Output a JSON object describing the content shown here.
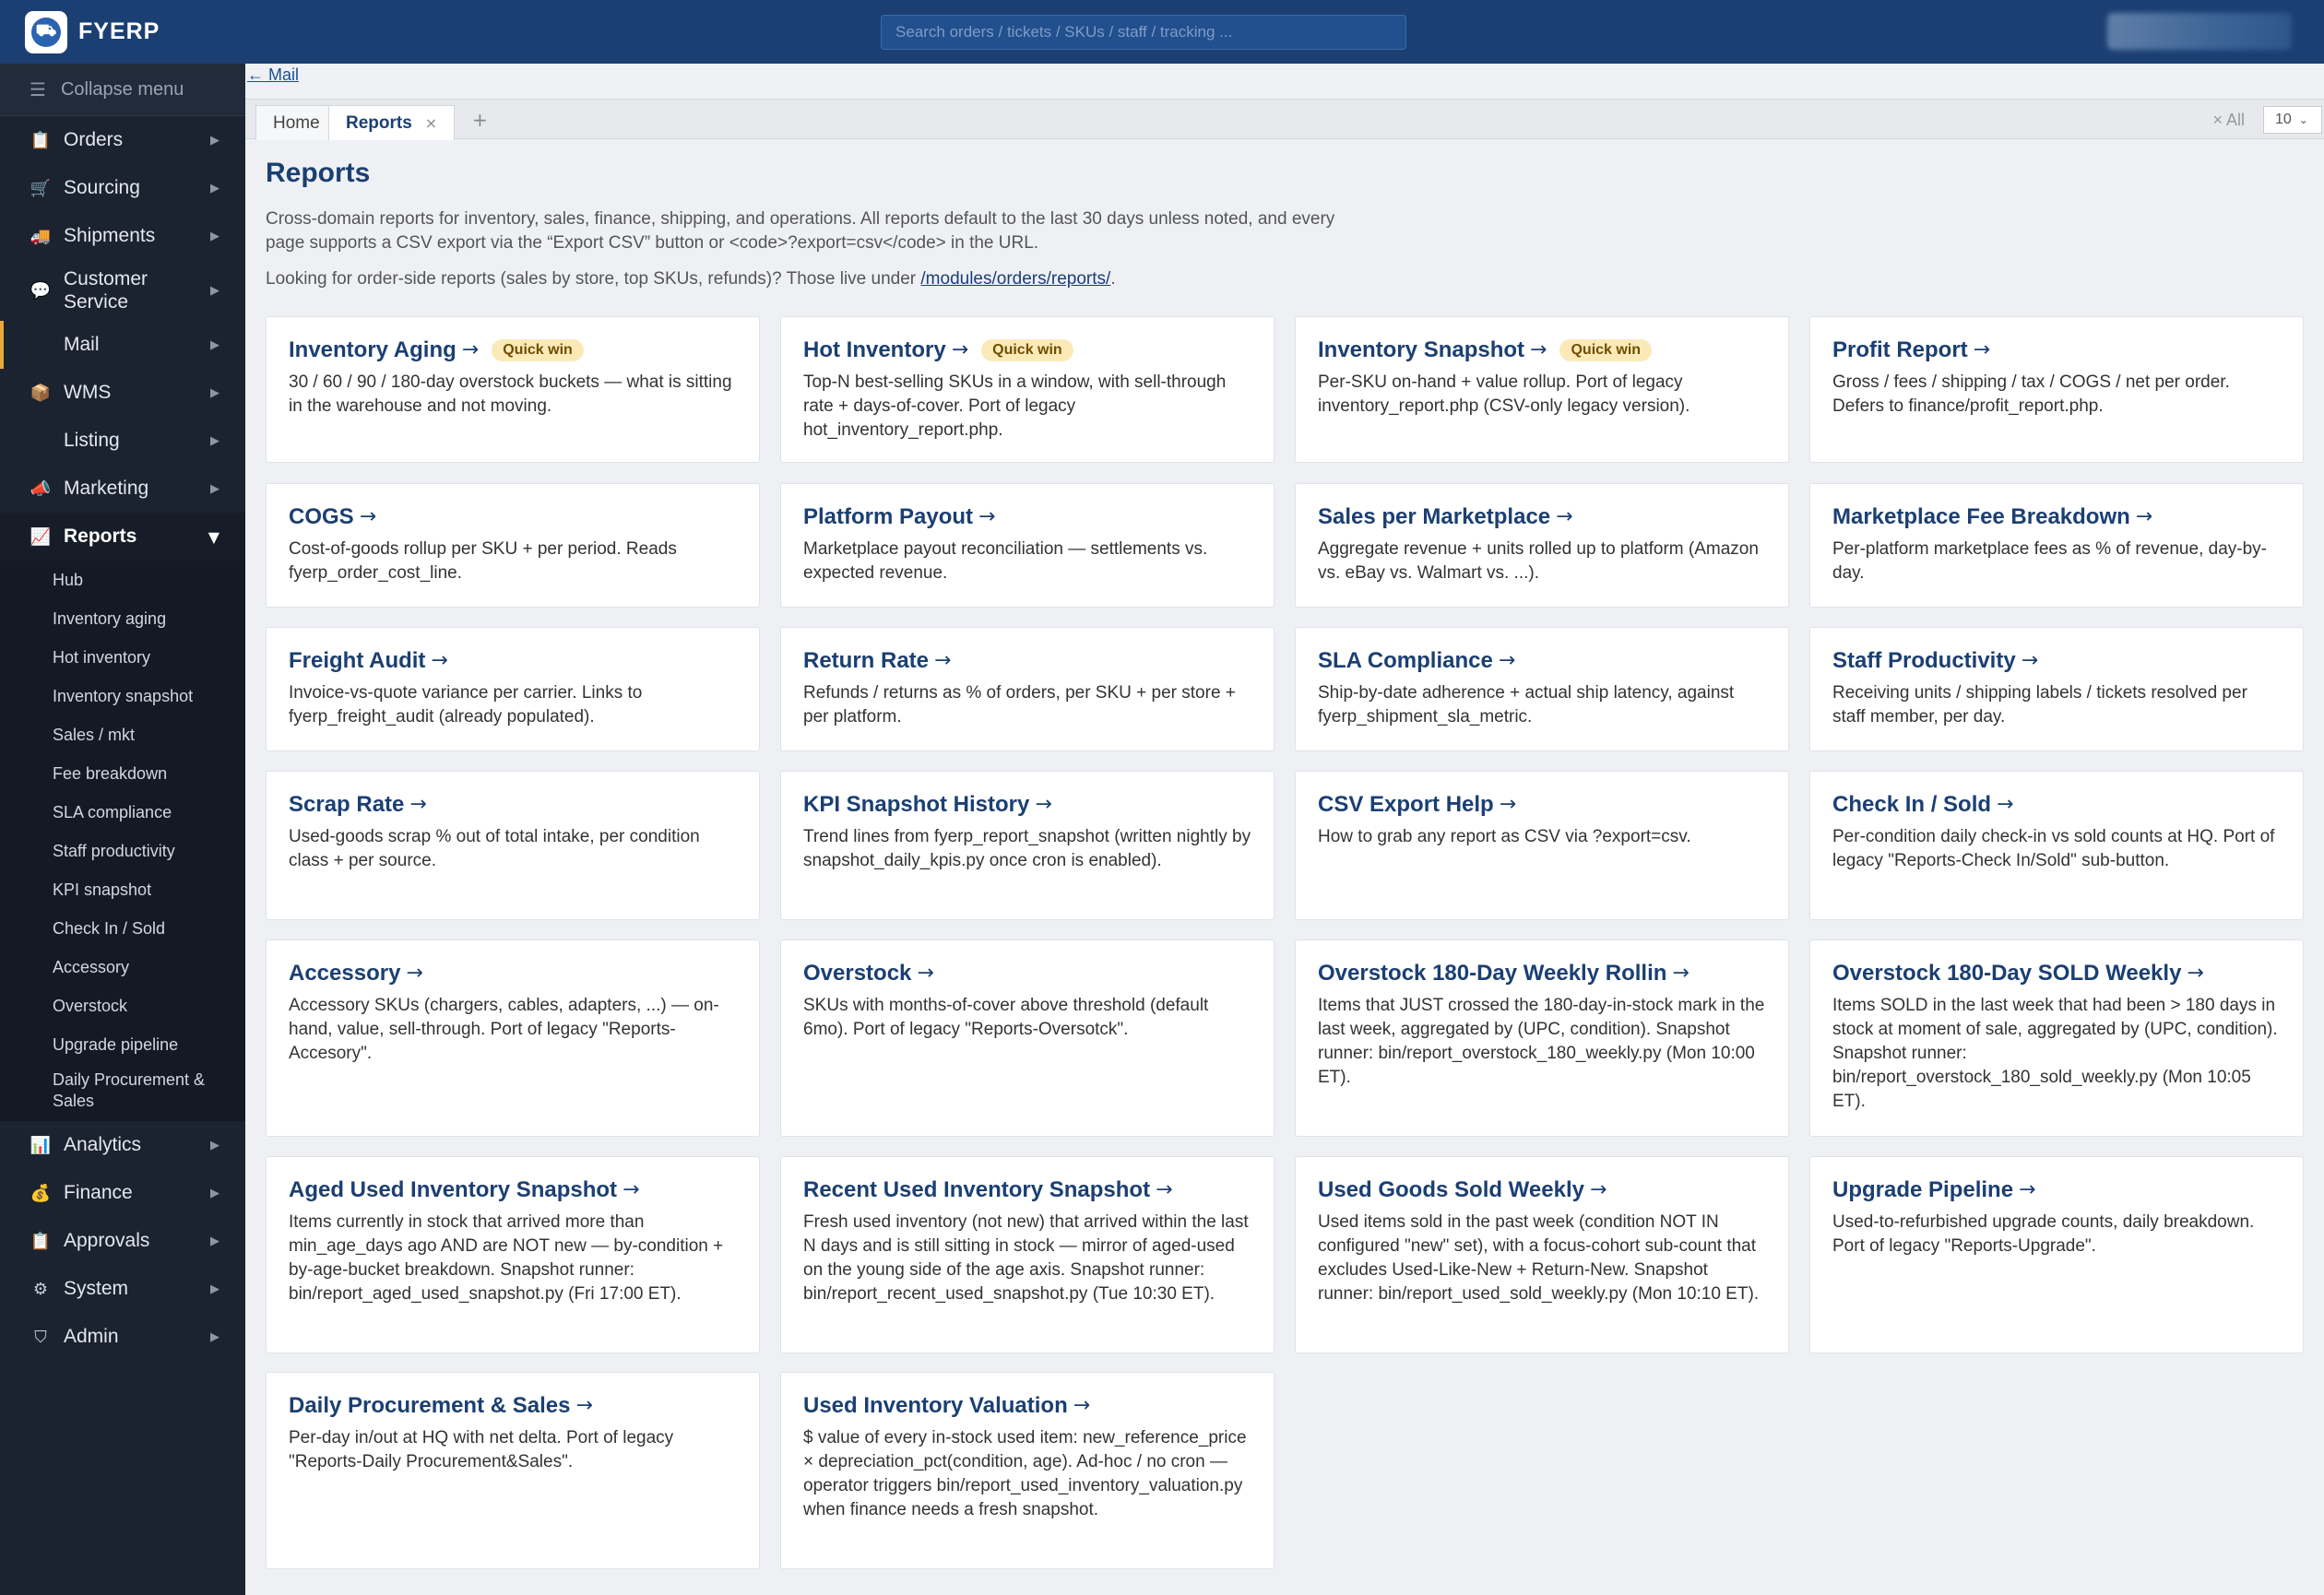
{
  "app": {
    "brand": "FYERP",
    "search_placeholder": "Search orders / tickets / SKUs / staff / tracking ..."
  },
  "sidebar": {
    "collapse_label": "Collapse menu",
    "items": [
      {
        "label": "Orders",
        "icon": "clipboard-icon"
      },
      {
        "label": "Sourcing",
        "icon": "cart-icon"
      },
      {
        "label": "Shipments",
        "icon": "truck-icon"
      },
      {
        "label": "Customer Service",
        "icon": "chat-icon"
      },
      {
        "label": "Mail",
        "icon": "mail-icon"
      },
      {
        "label": "WMS",
        "icon": "box-icon"
      },
      {
        "label": "Listing",
        "icon": "list-icon"
      },
      {
        "label": "Marketing",
        "icon": "megaphone-icon"
      },
      {
        "label": "Reports",
        "icon": "chart-icon"
      }
    ],
    "reports_sub": [
      "Hub",
      "Inventory aging",
      "Hot inventory",
      "Inventory snapshot",
      "Sales / mkt",
      "Fee breakdown",
      "SLA compliance",
      "Staff productivity",
      "KPI snapshot",
      "Check In / Sold",
      "Accessory",
      "Overstock",
      "Upgrade pipeline",
      "Daily Procurement & Sales"
    ],
    "items_after": [
      {
        "label": "Analytics",
        "icon": "bar-chart-icon"
      },
      {
        "label": "Finance",
        "icon": "money-bag-icon"
      },
      {
        "label": "Approvals",
        "icon": "approval-icon"
      },
      {
        "label": "System",
        "icon": "gear-icon"
      },
      {
        "label": "Admin",
        "icon": "shield-icon"
      }
    ]
  },
  "main": {
    "back_link": "← Mail",
    "tabs": [
      {
        "label": "Home"
      },
      {
        "label": "Reports",
        "close": "×"
      }
    ],
    "tab_add": "+",
    "tab_all": "× All",
    "page_size": "10",
    "title": "Reports",
    "intro": "Cross-domain reports for inventory, sales, finance, shipping, and operations. All reports default to the last 30 days unless noted, and every page supports a CSV export via the “Export CSV” button or <code>?export=csv</code> in the URL.",
    "intro2_prefix": "Looking for order-side reports (sales by store, top SKUs, refunds)? Those live under ",
    "intro2_link": "/modules/orders/reports/",
    "intro2_suffix": "."
  },
  "badge_label": "Quick win",
  "cards": [
    {
      "title": "Inventory Aging",
      "badge": true,
      "desc": "30 / 60 / 90 / 180-day overstock buckets — what is sitting in the warehouse and not moving."
    },
    {
      "title": "Hot Inventory",
      "badge": true,
      "desc": "Top-N best-selling SKUs in a window, with sell-through rate + days-of-cover. Port of legacy hot_inventory_report.php."
    },
    {
      "title": "Inventory Snapshot",
      "badge": true,
      "desc": "Per-SKU on-hand + value rollup. Port of legacy inventory_report.php (CSV-only legacy version)."
    },
    {
      "title": "Profit Report",
      "badge": false,
      "desc": "Gross / fees / shipping / tax / COGS / net per order. Defers to finance/profit_report.php."
    },
    {
      "title": "COGS",
      "badge": false,
      "desc": "Cost-of-goods rollup per SKU + per period. Reads fyerp_order_cost_line."
    },
    {
      "title": "Platform Payout",
      "badge": false,
      "desc": "Marketplace payout reconciliation — settlements vs. expected revenue."
    },
    {
      "title": "Sales per Marketplace",
      "badge": false,
      "desc": "Aggregate revenue + units rolled up to platform (Amazon vs. eBay vs. Walmart vs. ...)."
    },
    {
      "title": "Marketplace Fee Breakdown",
      "badge": false,
      "desc": "Per-platform marketplace fees as % of revenue, day-by-day."
    },
    {
      "title": "Freight Audit",
      "badge": false,
      "desc": "Invoice-vs-quote variance per carrier. Links to fyerp_freight_audit (already populated)."
    },
    {
      "title": "Return Rate",
      "badge": false,
      "desc": "Refunds / returns as % of orders, per SKU + per store + per platform."
    },
    {
      "title": "SLA Compliance",
      "badge": false,
      "desc": "Ship-by-date adherence + actual ship latency, against fyerp_shipment_sla_metric."
    },
    {
      "title": "Staff Productivity",
      "badge": false,
      "desc": "Receiving units / shipping labels / tickets resolved per staff member, per day."
    },
    {
      "title": "Scrap Rate",
      "badge": false,
      "desc": "Used-goods scrap % out of total intake, per condition class + per source."
    },
    {
      "title": "KPI Snapshot History",
      "badge": false,
      "desc": "Trend lines from fyerp_report_snapshot (written nightly by snapshot_daily_kpis.py once cron is enabled)."
    },
    {
      "title": "CSV Export Help",
      "badge": false,
      "desc": "How to grab any report as CSV via ?export=csv."
    },
    {
      "title": "Check In / Sold",
      "badge": false,
      "desc": "Per-condition daily check-in vs sold counts at HQ. Port of legacy \"Reports-Check In/Sold\" sub-button."
    },
    {
      "title": "Accessory",
      "badge": false,
      "desc": "Accessory SKUs (chargers, cables, adapters, ...) — on-hand, value, sell-through. Port of legacy \"Reports-Accesory\"."
    },
    {
      "title": "Overstock",
      "badge": false,
      "desc": "SKUs with months-of-cover above threshold (default 6mo). Port of legacy \"Reports-Oversotck\"."
    },
    {
      "title": "Overstock 180-Day Weekly Rollin",
      "badge": false,
      "desc": "Items that JUST crossed the 180-day-in-stock mark in the last week, aggregated by (UPC, condition). Snapshot runner: bin/report_overstock_180_weekly.py (Mon 10:00 ET)."
    },
    {
      "title": "Overstock 180-Day SOLD Weekly",
      "badge": false,
      "desc": "Items SOLD in the last week that had been > 180 days in stock at moment of sale, aggregated by (UPC, condition). Snapshot runner: bin/report_overstock_180_sold_weekly.py (Mon 10:05 ET)."
    },
    {
      "title": "Aged Used Inventory Snapshot",
      "badge": false,
      "desc": "Items currently in stock that arrived more than min_age_days ago AND are NOT new — by-condition + by-age-bucket breakdown. Snapshot runner: bin/report_aged_used_snapshot.py (Fri 17:00 ET)."
    },
    {
      "title": "Recent Used Inventory Snapshot",
      "badge": false,
      "desc": "Fresh used inventory (not new) that arrived within the last N days and is still sitting in stock — mirror of aged-used on the young side of the age axis. Snapshot runner: bin/report_recent_used_snapshot.py (Tue 10:30 ET)."
    },
    {
      "title": "Used Goods Sold Weekly",
      "badge": false,
      "desc": "Used items sold in the past week (condition NOT IN configured \"new\" set), with a focus-cohort sub-count that excludes Used-Like-New + Return-New. Snapshot runner: bin/report_used_sold_weekly.py (Mon 10:10 ET)."
    },
    {
      "title": "Upgrade Pipeline",
      "badge": false,
      "desc": "Used-to-refurbished upgrade counts, daily breakdown. Port of legacy \"Reports-Upgrade\"."
    },
    {
      "title": "Daily Procurement & Sales",
      "badge": false,
      "desc": "Per-day in/out at HQ with net delta. Port of legacy \"Reports-Daily Procurement&Sales\"."
    },
    {
      "title": "Used Inventory Valuation",
      "badge": false,
      "desc": "$ value of every in-stock used item: new_reference_price × depreciation_pct(condition, age). Ad-hoc / no cron — operator triggers bin/report_used_inventory_valuation.py when finance needs a fresh snapshot."
    }
  ]
}
